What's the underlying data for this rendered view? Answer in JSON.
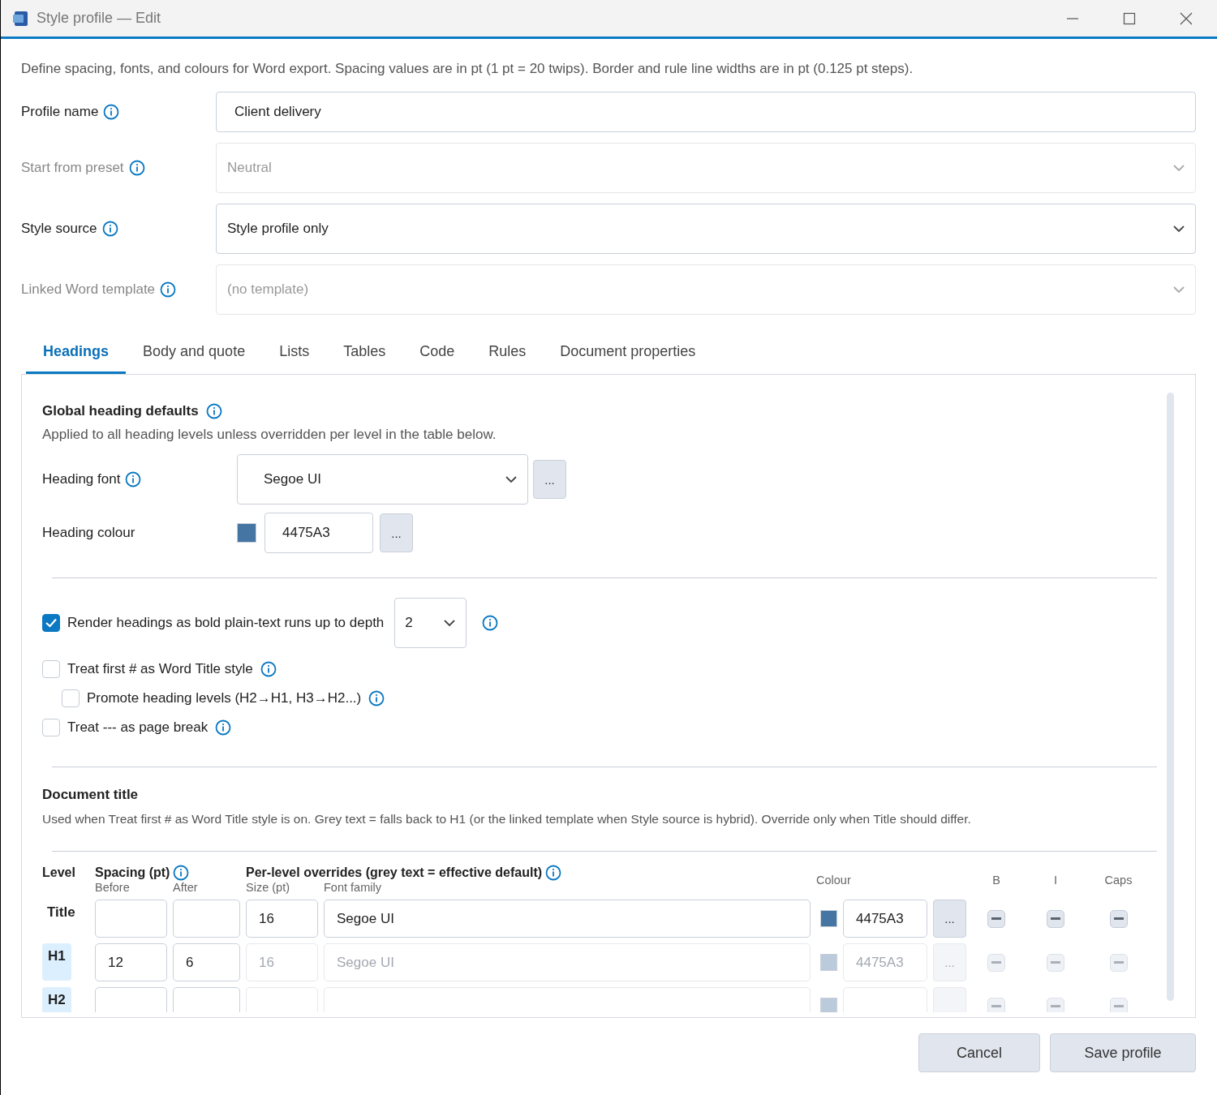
{
  "window": {
    "title": "Style profile — Edit"
  },
  "intro": "Define spacing, fonts, and colours for Word export. Spacing values are in pt (1 pt = 20 twips). Border and rule line widths are in pt (0.125 pt steps).",
  "fields": [
    {
      "label": "Profile name",
      "info": true,
      "kind": "text",
      "value": "Client delivery",
      "disabled": false
    },
    {
      "label": "Start from preset",
      "info": true,
      "kind": "select",
      "value": "Neutral",
      "disabled": true
    },
    {
      "label": "Style source",
      "info": true,
      "kind": "select",
      "value": "Style profile only",
      "disabled": false
    },
    {
      "label": "Linked Word template",
      "info": true,
      "kind": "select",
      "value": "(no template)",
      "disabled": true
    }
  ],
  "tabs": [
    {
      "label": "Headings",
      "selected": true
    },
    {
      "label": "Body and quote",
      "selected": false
    },
    {
      "label": "Lists",
      "selected": false
    },
    {
      "label": "Tables",
      "selected": false
    },
    {
      "label": "Code",
      "selected": false
    },
    {
      "label": "Rules",
      "selected": false
    },
    {
      "label": "Document properties",
      "selected": false
    }
  ],
  "global": {
    "title": "Global heading defaults",
    "subtitle": "Applied to all heading levels unless overridden per level in the table below.",
    "font": {
      "label": "Heading font",
      "value": "Segoe UI",
      "button": "..."
    },
    "colour": {
      "label": "Heading colour",
      "value": "4475A3",
      "color": "#4475a3",
      "button": "..."
    }
  },
  "options": [
    {
      "kind": "depth",
      "label": "Render headings as bold plain-text runs up to depth",
      "checked": true,
      "depth": "2",
      "info": true
    },
    {
      "kind": "plain",
      "label": "Treat first # as Word Title style",
      "checked": false,
      "info": true,
      "children": [
        {
          "kind": "plain",
          "label": "Promote heading levels (H2→H1, H3→H2...)",
          "checked": false,
          "info": true
        }
      ]
    },
    {
      "kind": "plain",
      "label": "Treat --- as page break",
      "checked": false,
      "info": true
    }
  ],
  "document_title": {
    "title": "Document title",
    "description": "Used when Treat first # as Word Title style is on. Grey text = falls back to H1 (or the linked template when Style source is hybrid). Override only when Title should differ."
  },
  "table": {
    "columns": {
      "level": "Level",
      "spacing": "Spacing (pt)",
      "before": "Before",
      "after": "After",
      "overrides": "Per-level overrides (grey text = effective default)",
      "size": "Size (pt)",
      "font": "Font family",
      "colour": "Colour",
      "bold": "B",
      "italic": "I",
      "caps": "Caps"
    },
    "rows": [
      {
        "level": "Title",
        "kind": "title",
        "before": "",
        "after": "",
        "size": "16",
        "font": "Segoe UI",
        "colour": "4475A3",
        "color": "#4475a3",
        "inherited": false,
        "button": "...",
        "bold_mixed": true,
        "italic_mixed": true,
        "caps_mixed": true
      },
      {
        "level": "H1",
        "kind": "level",
        "before": "12",
        "after": "6",
        "size": "16",
        "font": "Segoe UI",
        "colour": "4475A3",
        "color": "#bccbdb",
        "inherited": true,
        "button": "...",
        "bold_mixed": true,
        "italic_mixed": true,
        "caps_mixed": true
      },
      {
        "level": "H2",
        "kind": "level",
        "color": "#bccbdb",
        "inherited": true,
        "bold_mixed": true,
        "italic_mixed": true,
        "caps_mixed": true
      }
    ]
  },
  "buttons": [
    {
      "label": "Cancel"
    },
    {
      "label": "Save profile"
    }
  ]
}
